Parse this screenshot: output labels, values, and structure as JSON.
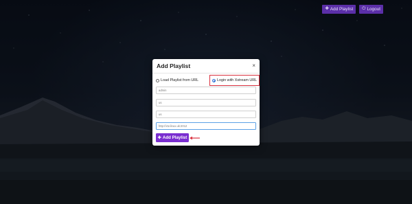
{
  "header": {
    "add_playlist_label": "Add Playlist",
    "logout_label": "Logout",
    "add_icon": "plus-icon",
    "logout_icon": "power-icon"
  },
  "modal": {
    "title": "Add Playlist",
    "close_glyph": "×",
    "options": [
      {
        "label": "Load Playlist from URL",
        "checked": false
      },
      {
        "label": "Login with Xstream URL",
        "checked": true
      }
    ],
    "fields": [
      {
        "value": "admin",
        "placeholder": ""
      },
      {
        "value": "us",
        "placeholder": ""
      },
      {
        "value": "us",
        "placeholder": ""
      },
      {
        "value": "http://xtv.linux.uk:2012",
        "placeholder": ""
      }
    ],
    "submit_label": "Add Playlist",
    "submit_icon": "plus-icon"
  },
  "colors": {
    "accent": "#7a2ed0",
    "header_button": "#5b2fa8",
    "highlight": "#d9303e",
    "focus": "#5aa0e6"
  }
}
